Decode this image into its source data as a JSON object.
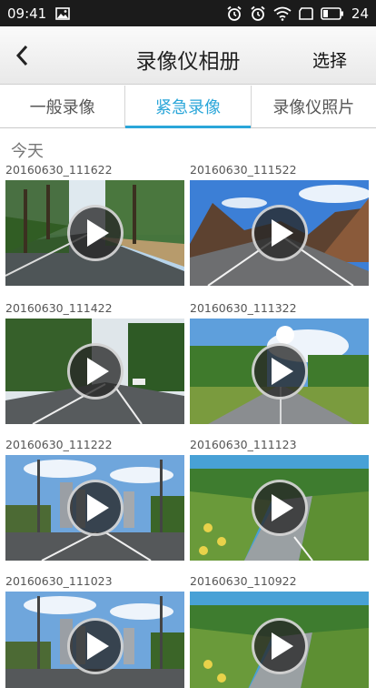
{
  "status_bar": {
    "time": "09:41",
    "battery_level": "24",
    "icons": [
      "image-icon",
      "alarm-clock-icon",
      "wifi-icon",
      "sim-card-icon",
      "battery-icon"
    ]
  },
  "nav": {
    "title": "录像仪相册",
    "select_label": "选择",
    "back_icon": "chevron-left-icon"
  },
  "tabs": [
    {
      "label": "一般录像",
      "active": false
    },
    {
      "label": "紧急录像",
      "active": true
    },
    {
      "label": "录像仪照片",
      "active": false
    }
  ],
  "section": {
    "title": "今天"
  },
  "videos": [
    {
      "name": "20160630_111622",
      "scene": "tree-road"
    },
    {
      "name": "20160630_111522",
      "scene": "mountain-road"
    },
    {
      "name": "20160630_111422",
      "scene": "forest-road"
    },
    {
      "name": "20160630_111322",
      "scene": "meadow-road"
    },
    {
      "name": "20160630_111222",
      "scene": "city-road"
    },
    {
      "name": "20160630_111123",
      "scene": "hill-road"
    },
    {
      "name": "20160630_111023",
      "scene": "city-road"
    },
    {
      "name": "20160630_110922",
      "scene": "hill-road"
    }
  ],
  "colors": {
    "accent": "#2aa6d9",
    "status_bar": "#1b1b1b"
  }
}
